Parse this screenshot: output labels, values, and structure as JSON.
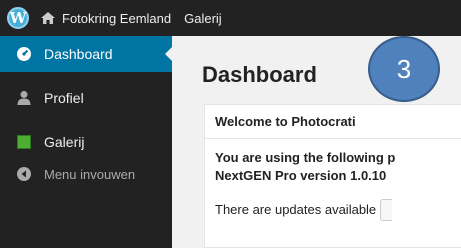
{
  "adminbar": {
    "site_name": "Fotokring Eemland",
    "galerij": "Galerij"
  },
  "sidebar": {
    "items": [
      {
        "label": "Dashboard",
        "icon": "dashboard-icon"
      },
      {
        "label": "Profiel",
        "icon": "user-icon"
      },
      {
        "label": "Galerij",
        "icon": "gallery-icon"
      },
      {
        "label": "Menu invouwen",
        "icon": "collapse-arrow-icon"
      }
    ]
  },
  "main": {
    "title": "Dashboard",
    "panel": {
      "heading": "Welcome to Photocrati",
      "line1": "You are using the following p",
      "line2": "NextGEN Pro version 1.0.10",
      "updates": "There are updates available"
    }
  },
  "badge": {
    "number": "3"
  },
  "colors": {
    "adminbar_bg": "#222222",
    "active_item": "#0074a2",
    "badge": "#4f81bd"
  }
}
